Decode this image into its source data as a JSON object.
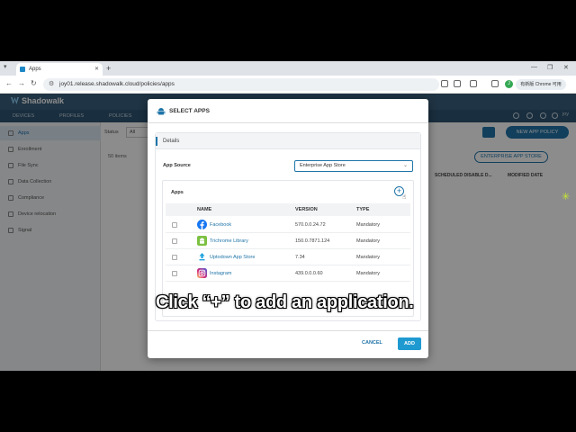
{
  "browser": {
    "tab_title": "Apps",
    "new_tab": "+",
    "url": "joy01.release.shadowalk.cloud/policies/apps",
    "avatar_letter": "J",
    "profile_button": "有新版 Chrome 可用",
    "window_controls": [
      "—",
      "❐",
      "✕"
    ]
  },
  "app": {
    "logo": "Shadowalk",
    "tabs": [
      "DEVICES",
      "PROFILES",
      "POLICIES"
    ],
    "user": "joy",
    "sidebar": [
      "Apps",
      "Enrollment",
      "File Sync",
      "Data Collection",
      "Compliance",
      "Device relocation",
      "Signal"
    ],
    "status_label": "Status",
    "status_value": "All",
    "new_policy": "NEW APP POLICY",
    "enterprise_store": "ENTERPRISE APP STORE",
    "items_per_page": "50 items",
    "columns": [
      "SCHEDULED DISABLE D...",
      "MODIFIED DATE"
    ]
  },
  "modal": {
    "title": "SELECT APPS",
    "details_title": "Details",
    "app_source_label": "App Source",
    "app_source_value": "Enterprise App Store",
    "apps_label": "Apps",
    "add_symbol": "+",
    "headers": {
      "name": "NAME",
      "version": "VERSION",
      "type": "TYPE"
    },
    "rows": [
      {
        "name": "Facebook",
        "version": "570.0.0.24.72",
        "type": "Mandatory",
        "icon": "facebook-icon",
        "color": "#1877f2"
      },
      {
        "name": "Trichrome Library",
        "version": "150.0.7871.124",
        "type": "Mandatory",
        "icon": "android-icon",
        "color": "#7cc142"
      },
      {
        "name": "Uptodown App Store",
        "version": "7.34",
        "type": "Mandatory",
        "icon": "uptodown-icon",
        "color": "#1fa3e0"
      },
      {
        "name": "Instagram",
        "version": "439.0.0.0.60",
        "type": "Mandatory",
        "icon": "instagram-icon",
        "color": "#d62976"
      }
    ],
    "cancel": "CANCEL",
    "add": "ADD"
  },
  "caption": "Click “+” to add an application.",
  "colors": {
    "accent": "#1f74a8",
    "header": "#3a5f7c",
    "add_button": "#1f9ad1"
  }
}
